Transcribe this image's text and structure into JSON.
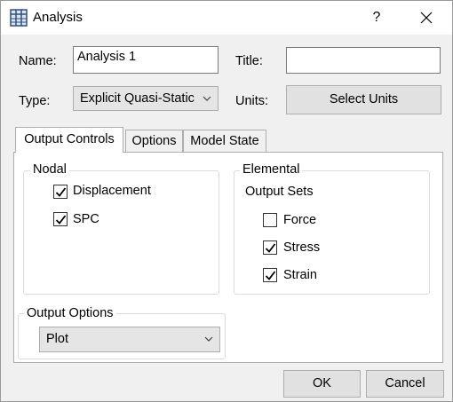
{
  "window": {
    "title": "Analysis",
    "help": "?",
    "app_icon": "table-grid-icon",
    "close_icon": "close-icon"
  },
  "form": {
    "name_label": "Name:",
    "name_value": "Analysis 1",
    "title_label": "Title:",
    "title_value": "",
    "type_label": "Type:",
    "type_value": "Explicit Quasi-Static",
    "units_label": "Units:",
    "select_units": "Select Units"
  },
  "tabs": [
    {
      "label": "Output Controls",
      "active": true
    },
    {
      "label": "Options",
      "active": false
    },
    {
      "label": "Model State",
      "active": false
    }
  ],
  "nodal": {
    "title": "Nodal",
    "items": [
      {
        "label": "Displacement",
        "checked": true
      },
      {
        "label": "SPC",
        "checked": true
      }
    ]
  },
  "elemental": {
    "title": "Elemental",
    "subtitle": "Output Sets",
    "items": [
      {
        "label": "Force",
        "checked": false
      },
      {
        "label": "Stress",
        "checked": true
      },
      {
        "label": "Strain",
        "checked": true
      }
    ]
  },
  "output_options": {
    "title": "Output Options",
    "value": "Plot"
  },
  "footer": {
    "ok": "OK",
    "cancel": "Cancel"
  }
}
